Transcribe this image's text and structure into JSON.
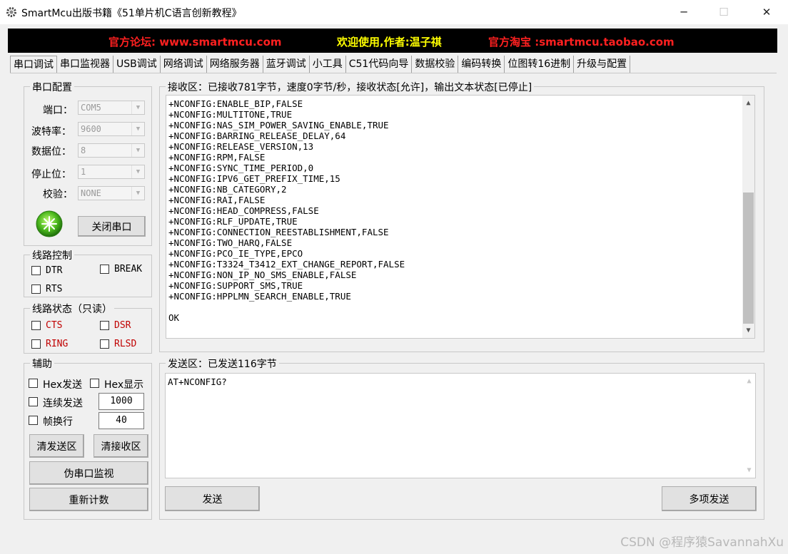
{
  "window": {
    "title": "SmartMcu出版书籍《51单片机C语言创新教程》",
    "minimize_glyph": "─",
    "maximize_glyph": "☐",
    "close_glyph": "✕"
  },
  "banner": {
    "forum": "官方论坛: www.smartmcu.com",
    "welcome": "欢迎使用,作者:温子祺",
    "shop": "官方淘宝 :smartmcu.taobao.com",
    "colors": {
      "forum": "#ff2020",
      "welcome": "#ffff00",
      "shop": "#ff2020"
    }
  },
  "tabs": [
    "串口调试",
    "串口监视器",
    "USB调试",
    "网络调试",
    "网络服务器",
    "蓝牙调试",
    "小工具",
    "C51代码向导",
    "数据校验",
    "编码转换",
    "位图转16进制",
    "升级与配置"
  ],
  "serial_config": {
    "group": "串口配置",
    "port_label": "端口：",
    "port_value": "COM5",
    "baud_label": "波特率：",
    "baud_value": "9600",
    "databits_label": "数据位：",
    "databits_value": "8",
    "stopbits_label": "停止位：",
    "stopbits_value": "1",
    "parity_label": "校验：",
    "parity_value": "NONE",
    "close_button": "关闭串口"
  },
  "line_control": {
    "group": "线路控制",
    "dtr": "DTR",
    "break": "BREAK",
    "rts": "RTS"
  },
  "line_status": {
    "group": "线路状态（只读）",
    "cts": "CTS",
    "dsr": "DSR",
    "ring": "RING",
    "rlsd": "RLSD"
  },
  "aux": {
    "group": "辅助",
    "hex_send": "Hex发送",
    "hex_show": "Hex显示",
    "continuous_send": "连续发送",
    "continuous_value": "1000",
    "frame_newline": "帧换行",
    "frame_value": "40",
    "clear_send": "清发送区",
    "clear_recv": "清接收区",
    "pseudo_monitor": "伪串口监视",
    "reset_count": "重新计数"
  },
  "receive": {
    "group": "接收区：已接收781字节，速度0字节/秒，接收状态[允许]，输出文本状态[已停止]",
    "lines": [
      "+NCONFIG:ENABLE_BIP,FALSE",
      "+NCONFIG:MULTITONE,TRUE",
      "+NCONFIG:NAS_SIM_POWER_SAVING_ENABLE,TRUE",
      "+NCONFIG:BARRING_RELEASE_DELAY,64",
      "+NCONFIG:RELEASE_VERSION,13",
      "+NCONFIG:RPM,FALSE",
      "+NCONFIG:SYNC_TIME_PERIOD,0",
      "+NCONFIG:IPV6_GET_PREFIX_TIME,15",
      "+NCONFIG:NB_CATEGORY,2",
      "+NCONFIG:RAI,FALSE",
      "+NCONFIG:HEAD_COMPRESS,FALSE",
      "+NCONFIG:RLF_UPDATE,TRUE",
      "+NCONFIG:CONNECTION_REESTABLISHMENT,FALSE",
      "+NCONFIG:TWO_HARQ,FALSE",
      "+NCONFIG:PCO_IE_TYPE,EPCO",
      "+NCONFIG:T3324_T3412_EXT_CHANGE_REPORT,FALSE",
      "+NCONFIG:NON_IP_NO_SMS_ENABLE,FALSE",
      "+NCONFIG:SUPPORT_SMS,TRUE",
      "+NCONFIG:HPPLMN_SEARCH_ENABLE,TRUE",
      "",
      "OK"
    ]
  },
  "send": {
    "group": "发送区：已发送116字节",
    "text": "AT+NCONFIG?",
    "send_button": "发送",
    "multi_send_button": "多项发送"
  },
  "watermark": "CSDN @程序猿SavannahXu"
}
